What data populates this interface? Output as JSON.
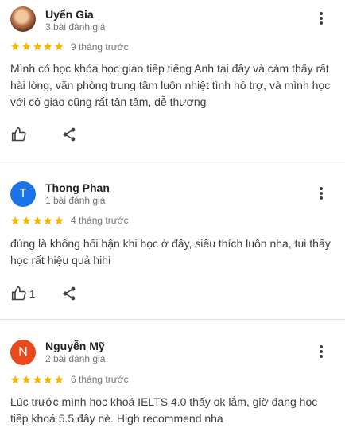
{
  "colors": {
    "star": "#f4b400",
    "avatar_thong": "#1a73e8",
    "avatar_nguyen": "#e8491d"
  },
  "icons": {
    "more": "more-vert-icon",
    "like": "thumb-up-icon",
    "share": "share-icon",
    "star": "star-icon"
  },
  "reviews": [
    {
      "name": "Uyển Gia",
      "review_count": "3 bài đánh giá",
      "rating": 5,
      "time": "9 tháng trước",
      "text": "Mình có học khóa học giao tiếp tiếng Anh tại đây và cảm thấy rất hài lòng, văn phòng trung tâm luôn nhiệt tình hỗ trợ, và mình học với cô giáo cũng rất tận tâm, dễ thương",
      "likes": ""
    },
    {
      "name": "Thong Phan",
      "initial": "T",
      "review_count": "1 bài đánh giá",
      "rating": 5,
      "time": "4 tháng trước",
      "text": "đúng là không hối hận khi học ở đây, siêu thích luôn nha, tui thấy học rất hiệu quả hihi",
      "likes": "1"
    },
    {
      "name": "Nguyễn Mỹ",
      "initial": "N",
      "review_count": "2 bài đánh giá",
      "rating": 5,
      "time": "6 tháng trước",
      "text": "Lúc trước mình học khoá IELTS 4.0 thấy ok lắm, giờ đang học tiếp khoá 5.5 đây nè. High recommend nha",
      "likes": ""
    }
  ]
}
